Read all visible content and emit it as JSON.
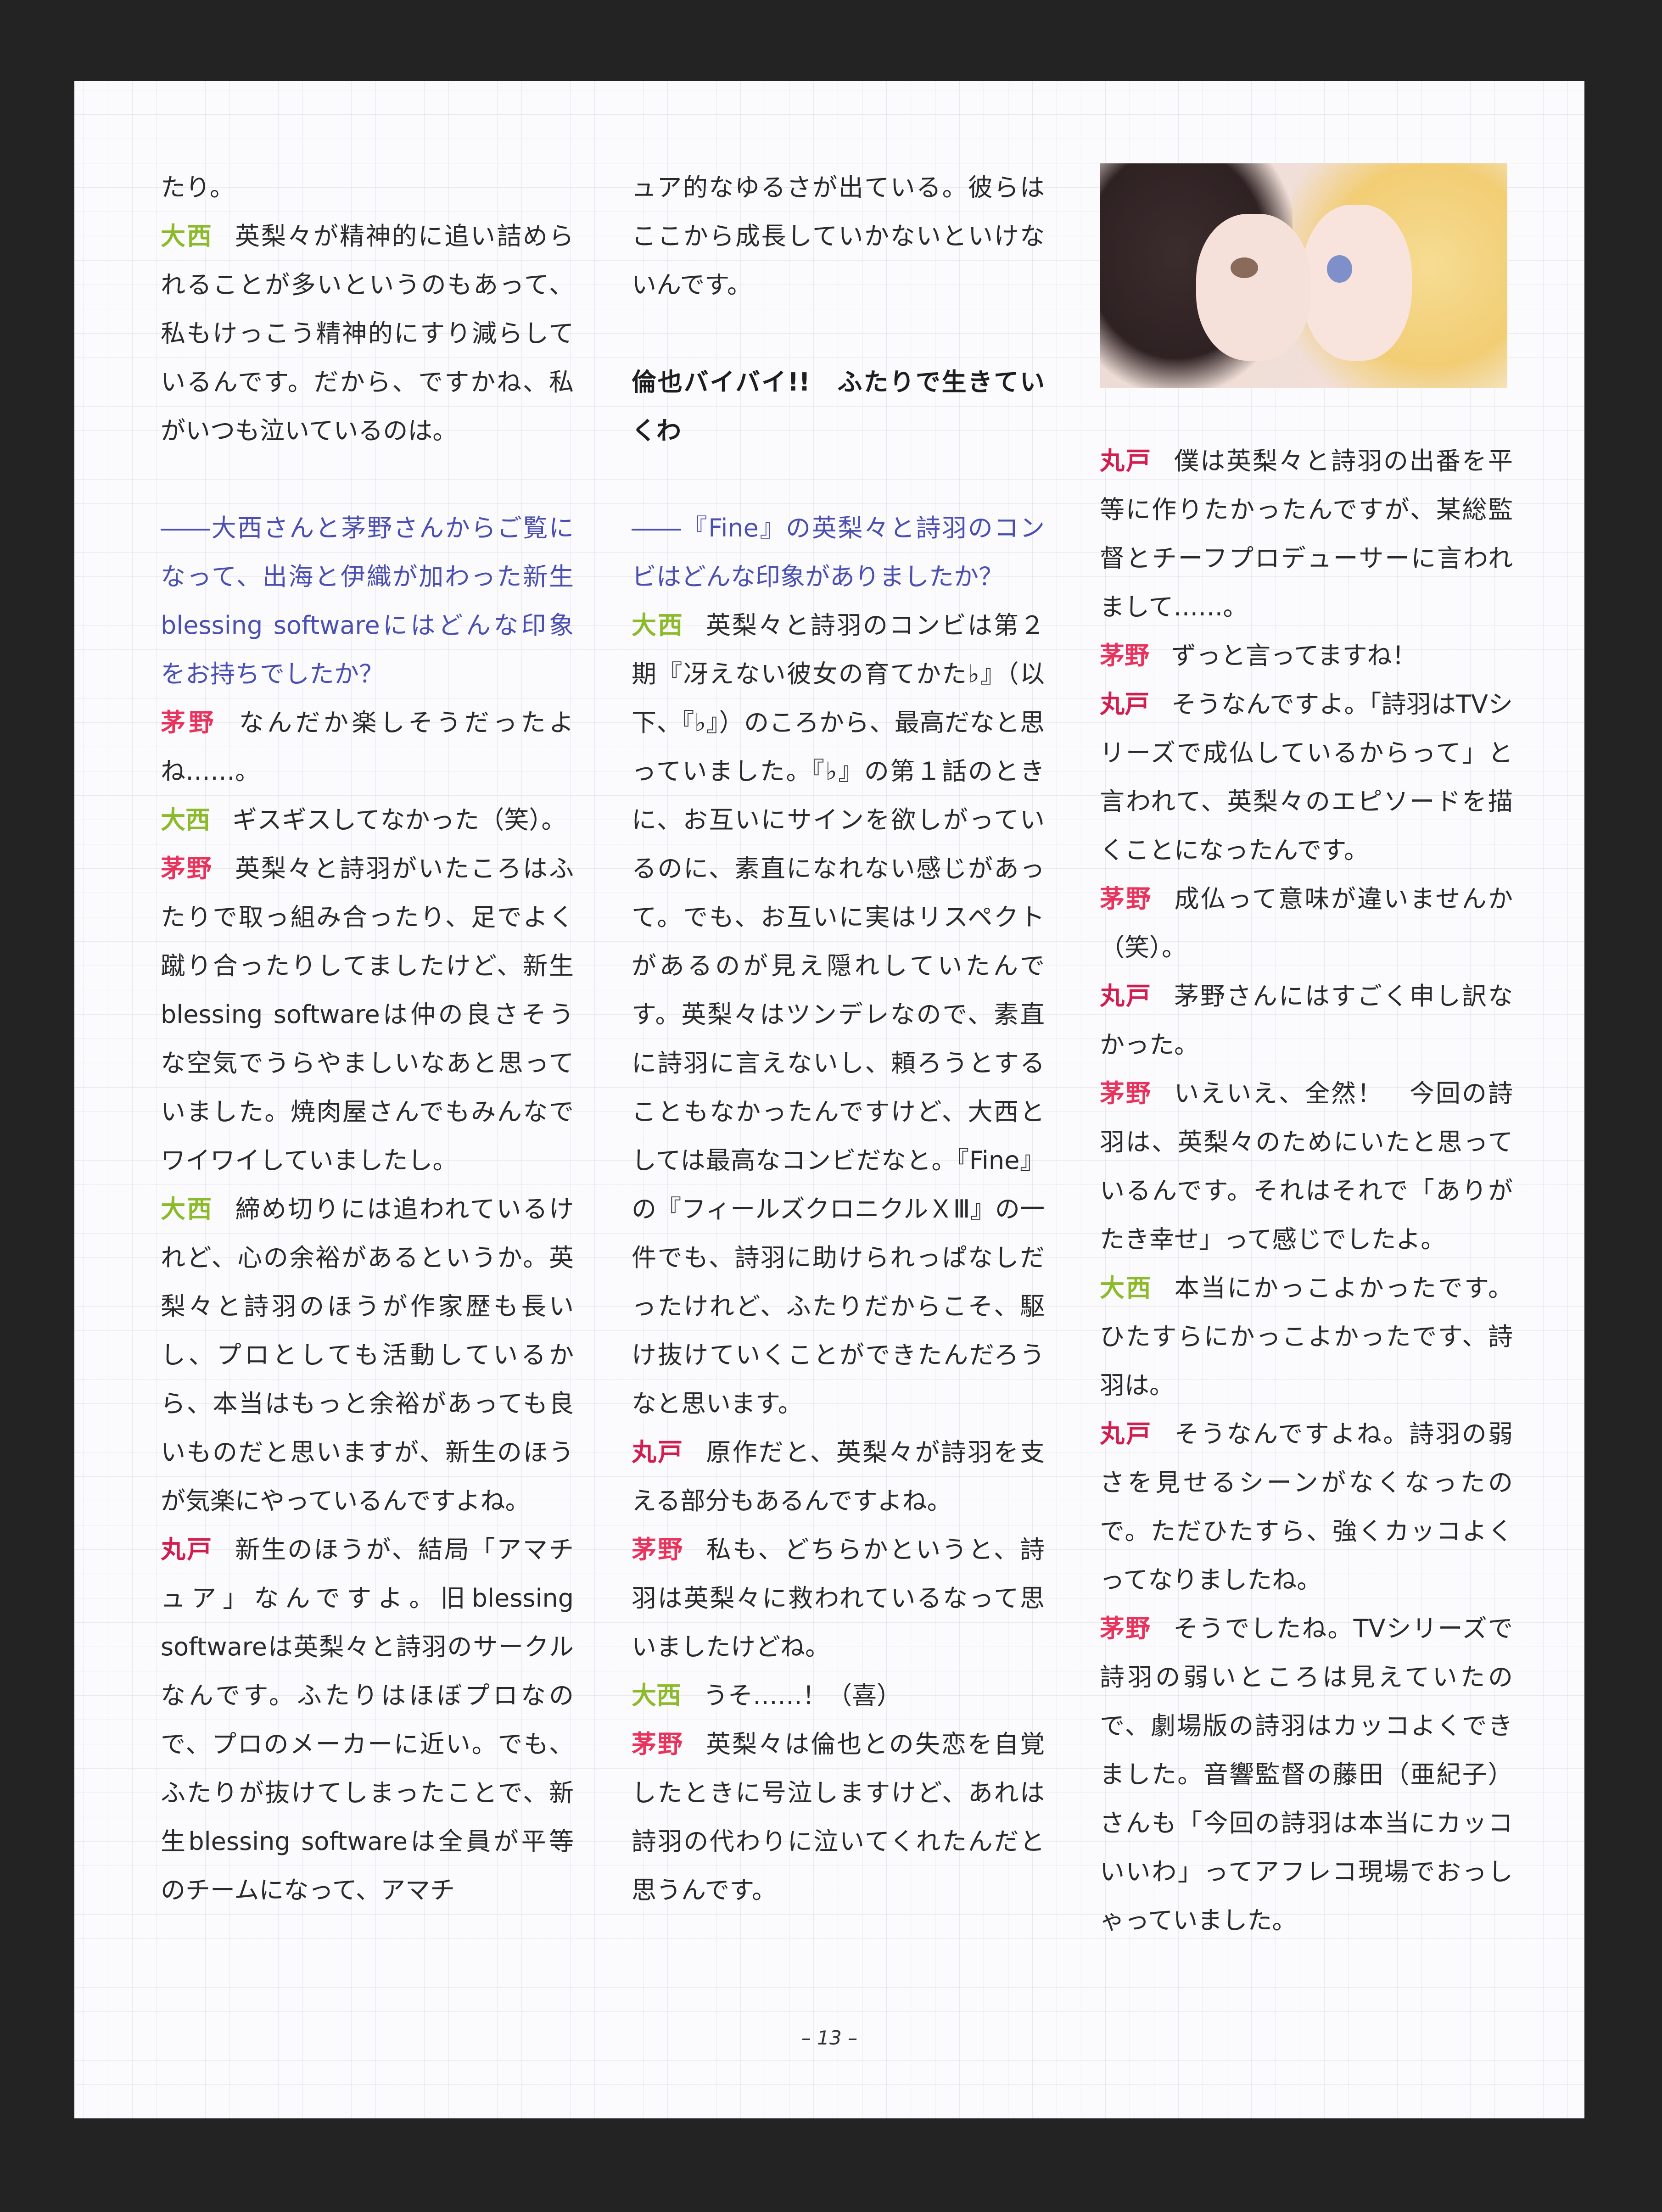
{
  "page_number": "– 13 –",
  "photo_icon": "anime-illustration-two-characters",
  "speakers": {
    "onishi": "大西",
    "kayano": "茅野",
    "maruto": "丸戸"
  },
  "col1": {
    "p1": "たり。",
    "p2": "英梨々が精神的に追い詰められることが多いというのもあって、私もけっこう精神的にすり減らしているんです。だから、ですかね、私がいつも泣いているのは。",
    "q1": "――大西さんと茅野さんからご覧になって、出海と伊織が加わった新生blessing softwareにはどんな印象をお持ちでしたか？",
    "p3": "なんだか楽しそうだったよね……。",
    "p4": "ギスギスしてなかった（笑）。",
    "p5": "英梨々と詩羽がいたころはふたりで取っ組み合ったり、足でよく蹴り合ったりしてましたけど、新生blessing softwareは仲の良さそうな空気でうらやましいなあと思っていました。焼肉屋さんでもみんなでワイワイしていましたし。",
    "p6": "締め切りには追われているけれど、心の余裕があるというか。英梨々と詩羽のほうが作家歴も長いし、プロとしても活動しているから、本当はもっと余裕があっても良いものだと思いますが、新生のほうが気楽にやっているんですよね。",
    "p7": "新生のほうが、結局「アマチュア」なんですよ。旧blessing softwareは英梨々と詩羽のサークルなんです。ふたりはほぼプロなので、プロのメーカーに近い。でも、ふたりが抜けてしまったことで、新生blessing softwareは全員が平等のチームになって、アマチ"
  },
  "col2": {
    "p1": "ュア的なゆるさが出ている。彼らはここから成長していかないといけないんです。",
    "heading": "倫也バイバイ!!　ふたりで生きていくわ",
    "q1": "――『Fine』の英梨々と詩羽のコンビはどんな印象がありましたか？",
    "p2": "英梨々と詩羽のコンビは第２期『冴えない彼女の育てかた♭』（以下、『♭』）のころから、最高だなと思っていました。『♭』の第１話のときに、お互いにサインを欲しがっているのに、素直になれない感じがあって。でも、お互いに実はリスペクトがあるのが見え隠れしていたんです。英梨々はツンデレなので、素直に詩羽に言えないし、頼ろうとすることもなかったんですけど、大西としては最高なコンビだなと。『Fine』の『フィールズクロニクルＸⅢ』の一件でも、詩羽に助けられっぱなしだったけれど、ふたりだからこそ、駆け抜けていくことができたんだろうなと思います。",
    "p3": "原作だと、英梨々が詩羽を支える部分もあるんですよね。",
    "p4": "私も、どちらかというと、詩羽は英梨々に救われているなって思いましたけどね。",
    "p5": "うそ……！（喜）",
    "p6": "英梨々は倫也との失恋を自覚したときに号泣しますけど、あれは詩羽の代わりに泣いてくれたんだと思うんです。"
  },
  "col3": {
    "p1": "僕は英梨々と詩羽の出番を平等に作りたかったんですが、某総監督とチーフプロデューサーに言われまして……。",
    "p2": "ずっと言ってますね！",
    "p3": "そうなんですよ。「詩羽はTVシリーズで成仏しているからって」と言われて、英梨々のエピソードを描くことになったんです。",
    "p4": "成仏って意味が違いませんか（笑）。",
    "p5": "茅野さんにはすごく申し訳なかった。",
    "p6": "いえいえ、全然！　今回の詩羽は、英梨々のためにいたと思っているんです。それはそれで「ありがたき幸せ」って感じでしたよ。",
    "p7": "本当にかっこよかったです。ひたすらにかっこよかったです、詩羽は。",
    "p8": "そうなんですよね。詩羽の弱さを見せるシーンがなくなったので。ただひたすら、強くカッコよくってなりましたね。",
    "p9": "そうでしたね。TVシリーズで詩羽の弱いところは見えていたので、劇場版の詩羽はカッコよくできました。音響監督の藤田（亜紀子）さんも「今回の詩羽は本当にカッコいいわ」ってアフレコ現場でおっしゃっていました。"
  }
}
